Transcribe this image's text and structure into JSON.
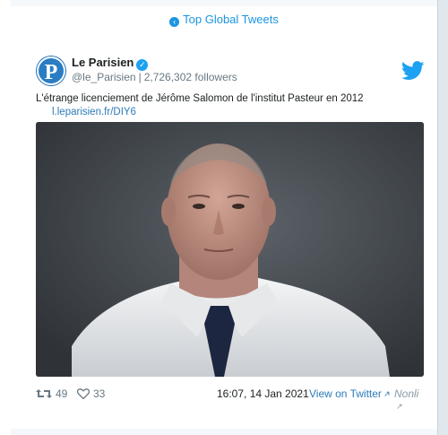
{
  "header": {
    "link_label": "Top Global Tweets",
    "icon": "circle-arrow-left-icon"
  },
  "tweet": {
    "avatar_letter": "P",
    "name": "Le Parisien",
    "verified_icon": "verified-badge-icon",
    "handle": "@le_Parisien",
    "separator": "|",
    "followers": "2,726,302 followers",
    "text": "L'étrange licenciement de Jérôme Salomon de l'institut Pasteur en 2012",
    "link": "l.leparisien.fr/DIY6",
    "retweets": "49",
    "likes": "33",
    "timestamp": "16:07, 14 Jan 2021",
    "dot": "·",
    "view_label": "View on Twitter",
    "nonli_label": "Nonli",
    "external_icon": "external-link-icon"
  },
  "colors": {
    "accent": "#1b95e0",
    "twitter_blue": "#1da1f2",
    "muted": "#697882",
    "brand_parisien": "#1e6fb5"
  }
}
